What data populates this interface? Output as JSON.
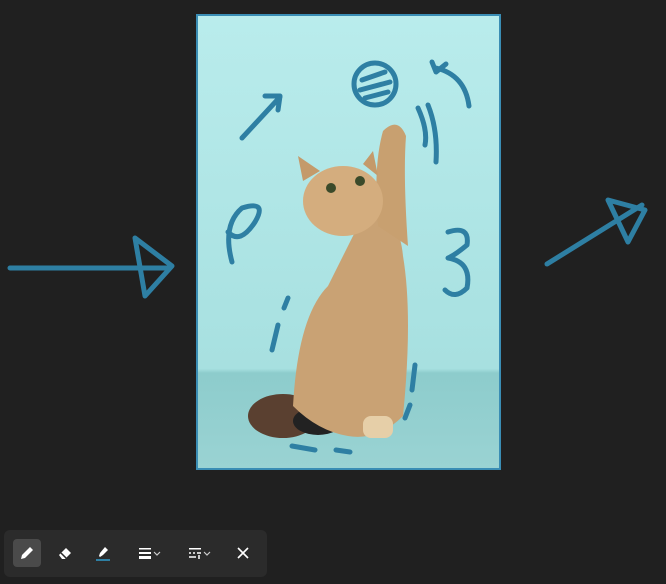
{
  "colors": {
    "ink": "#2e7fa3",
    "background": "#202020",
    "toolbar": "#2b2b2b",
    "selection_border": "#3a8db4"
  },
  "toolbar": {
    "tools": [
      {
        "icon": "pen-icon",
        "active": true
      },
      {
        "icon": "eraser-icon",
        "active": false
      },
      {
        "icon": "highlighter-icon",
        "active": false
      },
      {
        "icon": "stroke-width-icon",
        "has_dropdown": true
      },
      {
        "icon": "line-style-icon",
        "has_dropdown": true
      },
      {
        "icon": "close-icon"
      }
    ]
  }
}
